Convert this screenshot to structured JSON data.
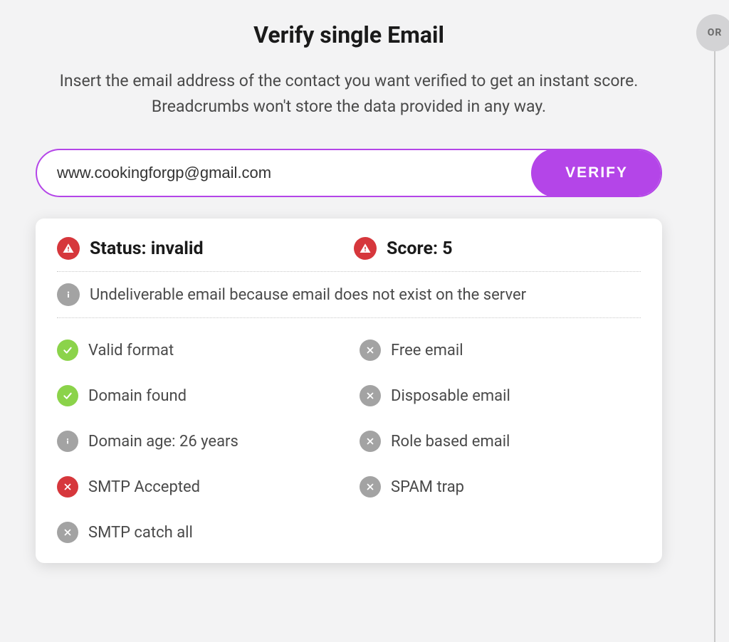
{
  "header": {
    "title": "Verify single Email",
    "description": "Insert the email address of the contact you want verified to get an instant score. Breadcrumbs won't store the data provided in any way."
  },
  "form": {
    "email_value": "www.cookingforgp@gmail.com",
    "verify_label": "VERIFY"
  },
  "result": {
    "status_label": "Status: invalid",
    "score_label": "Score: 5",
    "reason": "Undeliverable email because email does not exist on the server"
  },
  "checks": {
    "left": [
      {
        "label": "Valid format",
        "icon": "check"
      },
      {
        "label": "Domain found",
        "icon": "check"
      },
      {
        "label": "Domain age: 26 years",
        "icon": "info"
      },
      {
        "label": "SMTP Accepted",
        "icon": "cross-red"
      },
      {
        "label": "SMTP catch all",
        "icon": "cross-gray"
      }
    ],
    "right": [
      {
        "label": "Free email",
        "icon": "cross-gray"
      },
      {
        "label": "Disposable email",
        "icon": "cross-gray"
      },
      {
        "label": "Role based email",
        "icon": "cross-gray"
      },
      {
        "label": "SPAM trap",
        "icon": "cross-gray"
      }
    ]
  },
  "side": {
    "or_label": "OR"
  },
  "colors": {
    "accent": "#b445e8",
    "danger": "#d6373c",
    "success": "#8bd34a",
    "muted": "#a3a3a3"
  }
}
